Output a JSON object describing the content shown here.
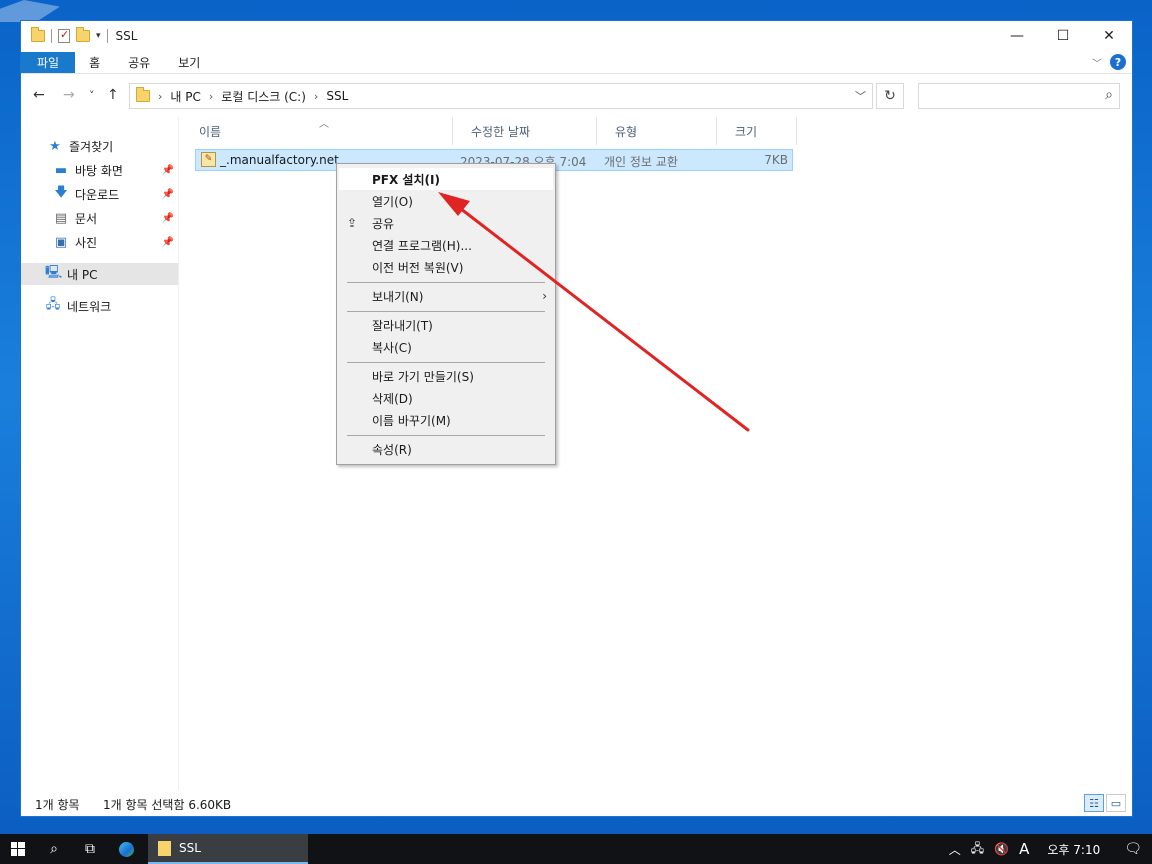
{
  "window": {
    "title": "SSL",
    "caption": {
      "minimize": "—",
      "maximize": "☐",
      "close": "✕"
    }
  },
  "ribbon": {
    "tabs": [
      "파일",
      "홈",
      "공유",
      "보기"
    ],
    "help": "?"
  },
  "nav": {
    "back": "←",
    "forward": "→",
    "recent": "˅",
    "up": "↑",
    "breadcrumb": [
      "내 PC",
      "로컬 디스크 (C:)",
      "SSL"
    ],
    "separator": "›",
    "search_placeholder": ""
  },
  "sidebar": {
    "quick_access": "즐겨찾기",
    "pinned": [
      "바탕 화면",
      "다운로드",
      "문서",
      "사진"
    ],
    "this_pc": "내 PC",
    "network": "네트워크"
  },
  "columns": {
    "name": "이름",
    "date": "수정한 날짜",
    "type": "유형",
    "size": "크기"
  },
  "files": [
    {
      "name": "_.manualfactory.net",
      "date": "2023-07-28 오후 7:04",
      "type": "개인 정보 교환",
      "size": "7KB"
    }
  ],
  "context_menu": {
    "items": [
      "PFX 설치(I)",
      "열기(O)",
      "공유",
      "연결 프로그램(H)...",
      "이전 버전 복원(V)",
      "보내기(N)",
      "잘라내기(T)",
      "복사(C)",
      "바로 가기 만들기(S)",
      "삭제(D)",
      "이름 바꾸기(M)",
      "속성(R)"
    ]
  },
  "status": {
    "count": "1개 항목",
    "selection": "1개 항목 선택함 6.60KB"
  },
  "taskbar": {
    "app_label": "SSL",
    "ime": "A",
    "clock": "오후 7:10"
  },
  "colors": {
    "accent": "#1979ca",
    "selection": "#cce8ff",
    "annotation_arrow": "#e02424",
    "desktop": "#0a63c8"
  }
}
